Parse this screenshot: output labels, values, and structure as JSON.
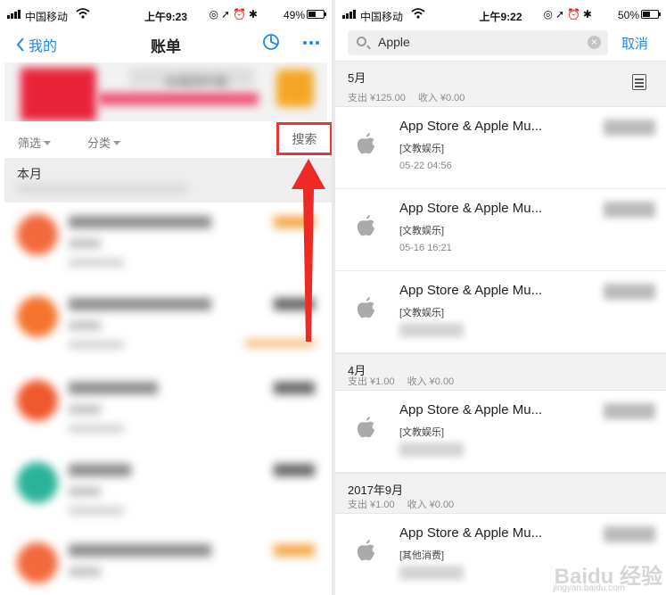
{
  "left": {
    "status": {
      "carrier": "中国移动",
      "time": "上午9:23",
      "battery": "49%",
      "battery_level": 0.49
    },
    "nav": {
      "back": "我的",
      "title": "账单"
    },
    "banner": {
      "text": "水城流升级"
    },
    "filters": {
      "filter": "筛选",
      "category": "分类",
      "search": "搜索"
    },
    "month": "本月",
    "colors": {
      "accent": "#1e88e5",
      "highlight": "#e53935"
    }
  },
  "right": {
    "status": {
      "carrier": "中国移动",
      "time": "上午9:22",
      "battery": "50%",
      "battery_level": 0.5
    },
    "search": {
      "value": "Apple",
      "cancel": "取消"
    },
    "sections": [
      {
        "month": "5月",
        "spend": "支出 ¥125.00",
        "income": "收入 ¥0.00",
        "items": [
          {
            "name": "App Store & Apple Mu...",
            "category": "[文教娱乐]",
            "date": "05-22  04:56"
          },
          {
            "name": "App Store & Apple Mu...",
            "category": "[文教娱乐]",
            "date": "05-16  16:21"
          },
          {
            "name": "App Store & Apple Mu...",
            "category": "[文教娱乐]",
            "date": ""
          }
        ]
      },
      {
        "month": "4月",
        "spend": "支出 ¥1.00",
        "income": "收入 ¥0.00",
        "items": [
          {
            "name": "App Store & Apple Mu...",
            "category": "[文教娱乐]",
            "date": ""
          }
        ]
      },
      {
        "month": "2017年9月",
        "spend": "支出 ¥1.00",
        "income": "收入 ¥0.00",
        "items": [
          {
            "name": "App Store & Apple Mu...",
            "category": "[其他消费]",
            "date": ""
          }
        ]
      }
    ],
    "watermark": {
      "brand": "Baidu 经验",
      "url": "jingyan.baidu.com"
    }
  }
}
